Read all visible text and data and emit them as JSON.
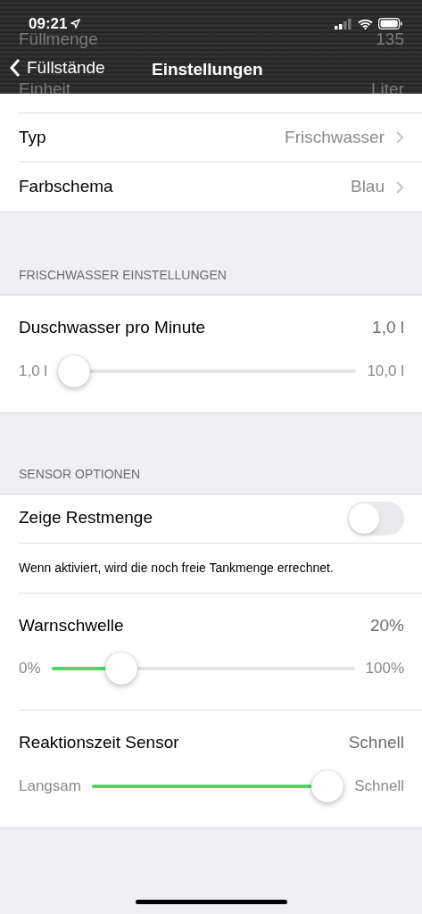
{
  "status_bar": {
    "time": "09:21"
  },
  "behind_bar": [
    {
      "label": "Füllmenge",
      "value": "135"
    },
    {
      "label": "Einheit",
      "value": "Liter"
    }
  ],
  "nav": {
    "back": "Füllstände",
    "title": "Einstellungen"
  },
  "rows": [
    {
      "label": "Typ",
      "value": "Frischwasser"
    },
    {
      "label": "Farbschema",
      "value": "Blau"
    }
  ],
  "sections": [
    {
      "header": "FRISCHWASSER EINSTELLUNGEN",
      "items": [
        {
          "kind": "slider",
          "label": "Duschwasser pro Minute",
          "value": "1,0 l",
          "min_label": "1,0 l",
          "max_label": "10,0 l",
          "level": 0
        }
      ]
    },
    {
      "header": "SENSOR OPTIONEN",
      "items": [
        {
          "kind": "toggle",
          "label": "Zeige Restmenge",
          "on": false
        },
        {
          "kind": "note",
          "text": "Wenn aktiviert, wird die noch freie Tankmenge errechnet."
        },
        {
          "kind": "slider",
          "label": "Warnschwelle",
          "value": "20%",
          "min_label": "0%",
          "max_label": "100%",
          "level": 0.2
        },
        {
          "kind": "slider",
          "label": "Reaktionszeit Sensor",
          "value": "Schnell",
          "min_label": "Langsam",
          "max_label": "Schnell",
          "level": 1
        }
      ]
    }
  ]
}
